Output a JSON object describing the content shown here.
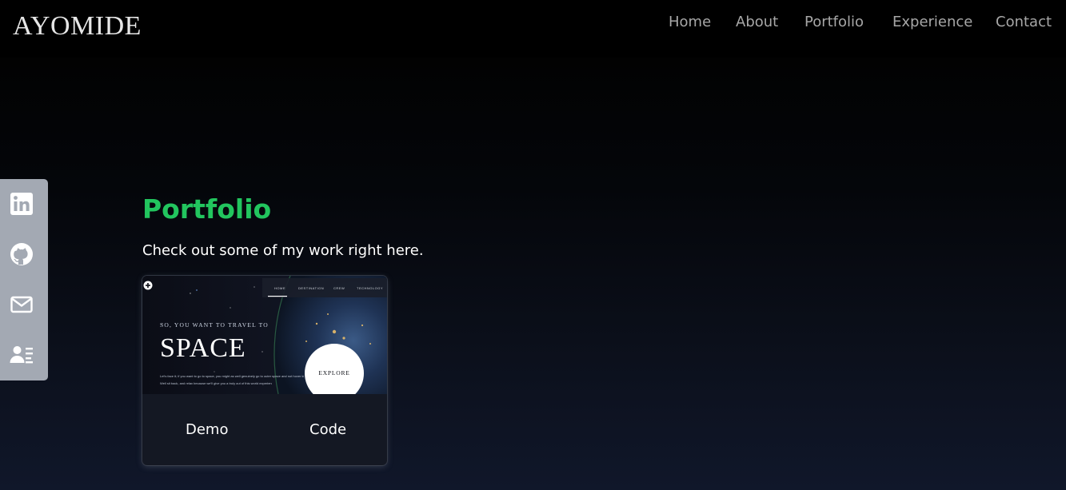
{
  "navbar": {
    "brand": "AYOMIDE",
    "links": [
      "Home",
      "About",
      "Portfolio",
      "Experience",
      "Contact"
    ]
  },
  "social": {
    "icons": [
      "linkedin-icon",
      "github-icon",
      "mail-icon",
      "resume-icon"
    ],
    "bar_color": "#a3a9b3"
  },
  "portfolio": {
    "title": "Portfolio",
    "subtitle": "Check out some of my work right here.",
    "title_color": "#22c55e",
    "project": {
      "thumb_nav": [
        "HOME",
        "DESTINATION",
        "CREW",
        "TECHNOLOGY"
      ],
      "thumb_kicker": "SO, YOU WANT TO TRAVEL TO",
      "thumb_heading": "SPACE",
      "thumb_body_1": "Let's face it; if you want to go to space, you might as well genuinely go to outer space and not hover kind of on the edge of it.",
      "thumb_body_2": "Well sit back, and relax because we'll give you a truly out of this world experience!",
      "thumb_cta": "EXPLORE",
      "demo_label": "Demo",
      "code_label": "Code"
    }
  }
}
